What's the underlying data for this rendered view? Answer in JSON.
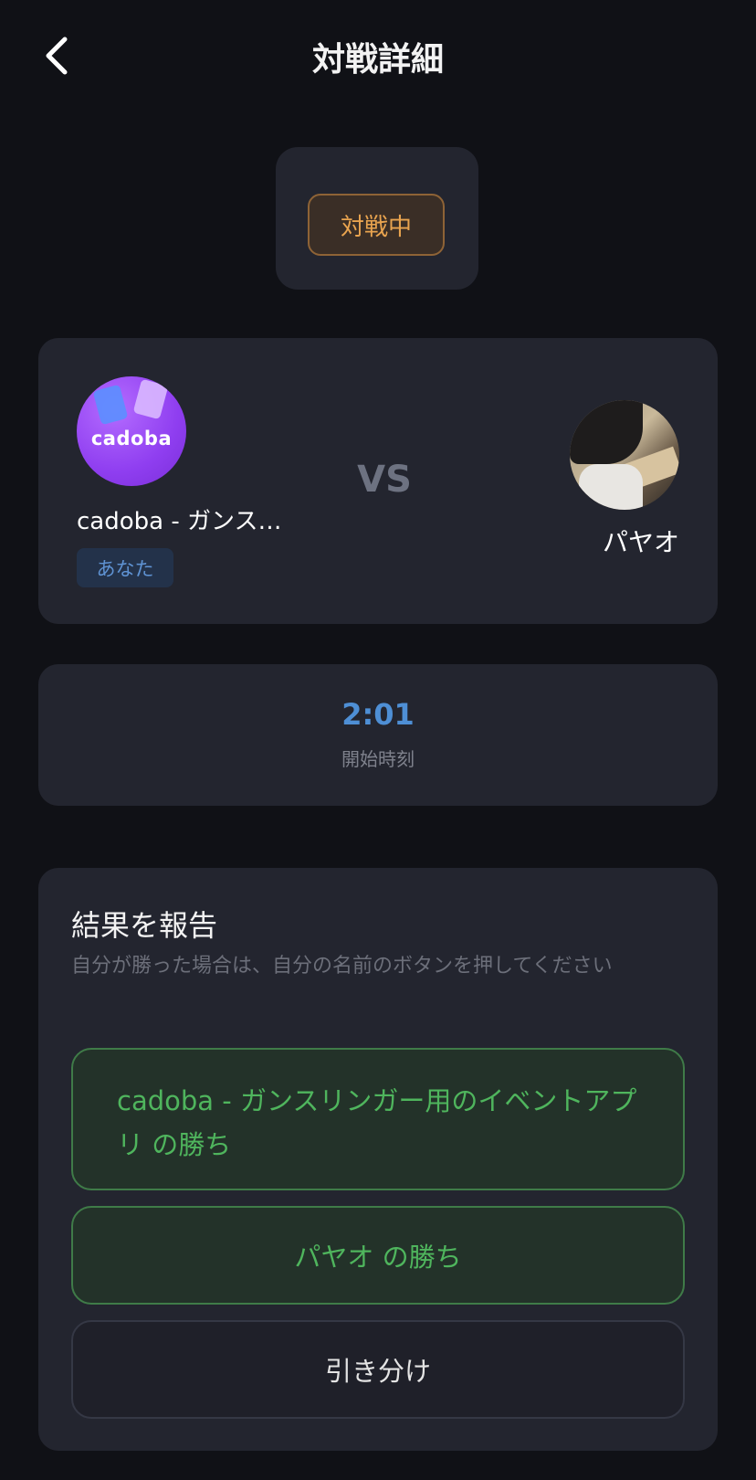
{
  "header": {
    "title": "対戦詳細",
    "back_icon": "chevron-left-icon"
  },
  "status": {
    "label": "対戦中",
    "color": "#e9a44f"
  },
  "match": {
    "player1": {
      "avatar_text": "cadoba",
      "name": "cadoba - ガンス…",
      "badge": "あなた"
    },
    "vs_label": "VS",
    "player2": {
      "name": "パヤオ"
    }
  },
  "start_time": {
    "value": "2:01",
    "label": "開始時刻"
  },
  "report": {
    "title": "結果を報告",
    "description": "自分が勝った場合は、自分の名前のボタンを押してください",
    "win_player1_label": "cadoba - ガンスリンガー用のイベントアプリ の勝ち",
    "win_player2_label": "パヤオ の勝ち",
    "draw_label": "引き分け"
  },
  "colors": {
    "background": "#101116",
    "card": "#23252f",
    "accent_blue": "#4e8fd5",
    "win_green": "#4fb55d"
  }
}
